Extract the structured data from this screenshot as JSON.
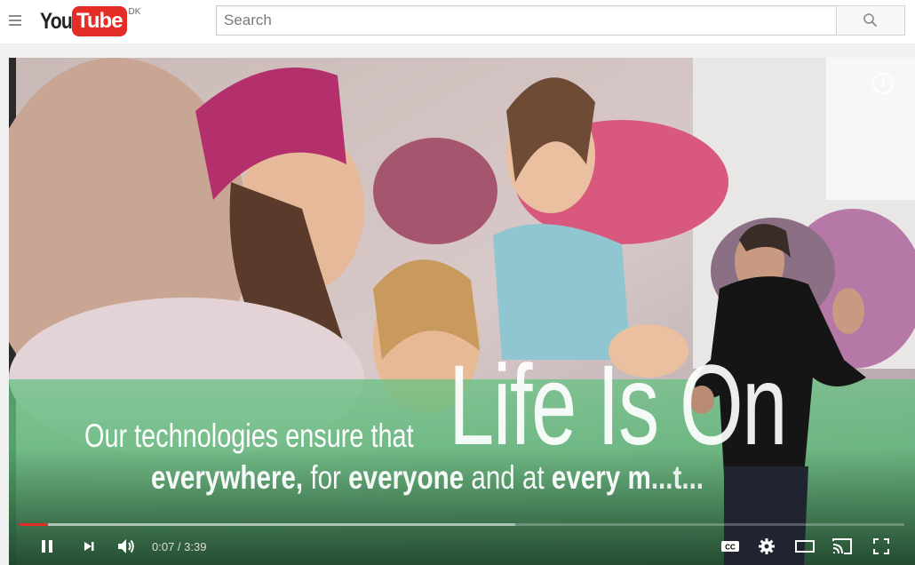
{
  "header": {
    "logo_you": "You",
    "logo_tube": "Tube",
    "region": "DK",
    "search_placeholder": "Search",
    "brand_color": "#e52d27"
  },
  "video": {
    "slide_line_1": "Our technologies ensure that",
    "slide_headline": "Life Is On",
    "slide_line_2_a": "everywhere,",
    "slide_line_2_b": " for ",
    "slide_line_2_c": "everyone",
    "slide_line_2_d": " and at ",
    "slide_line_2_e": "every m",
    "slide_line_2_f": "...t...",
    "slide_band_color": "#5fbf7a"
  },
  "player": {
    "current_time": "0:07",
    "duration": "3:39",
    "time_display": "0:07 / 3:39",
    "played_fraction": 0.032,
    "loaded_fraction": 0.56,
    "icons": [
      "pause-icon",
      "next-icon",
      "volume-icon",
      "captions-icon",
      "settings-icon",
      "theater-icon",
      "cast-icon",
      "fullscreen-icon",
      "info-icon"
    ]
  }
}
